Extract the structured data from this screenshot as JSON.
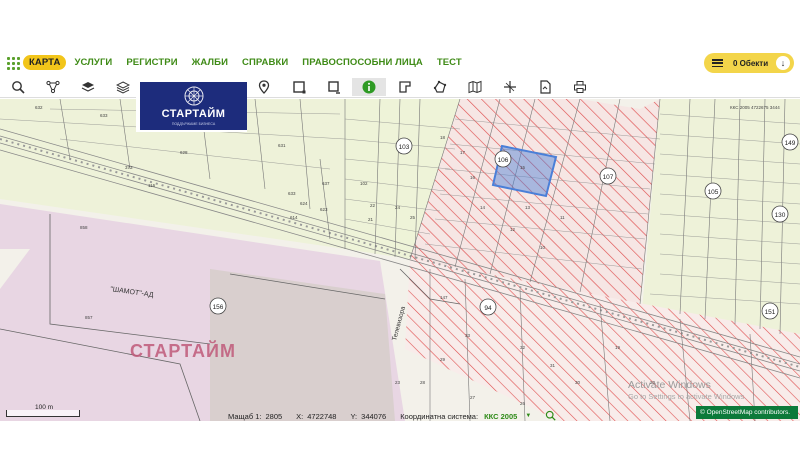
{
  "nav": {
    "items": [
      "КАРТА",
      "УСЛУГИ",
      "РЕГИСТРИ",
      "ЖАЛБИ",
      "СПРАВКИ",
      "ПРАВОСПОСОБНИ ЛИЦА",
      "ТЕСТ"
    ],
    "active": "КАРТА"
  },
  "objects_button": {
    "label": "0 Обекти"
  },
  "toolbar": {
    "tools": [
      "search-icon",
      "path-icon",
      "layers-icon",
      "layers-outline-icon",
      "location-pin-icon",
      "select-rectangle-icon",
      "select-area-icon",
      "info-icon",
      "parcel-icon",
      "polygon-icon",
      "map-icon",
      "coordinates-icon",
      "document-icon",
      "print-icon"
    ],
    "active_tool": "info-icon"
  },
  "logo": {
    "title": "СТАРТАЙМ",
    "subtitle": "ПОДДЪРЖАМЕ БИЗНЕСА"
  },
  "map": {
    "watermark": "СТАРТАЙМ",
    "factory_label": "\"ШАМОТ\"-АД",
    "street_label": "Телевизора",
    "header_text": "ККС 2005 4722675 3444",
    "blocks": [
      "103",
      "106",
      "107",
      "105",
      "149",
      "130",
      "151",
      "156"
    ],
    "parcels": [
      "632",
      "633",
      "620",
      "628",
      "630",
      "631",
      "637",
      "624",
      "623",
      "614",
      "373",
      "116",
      "148",
      "102",
      "22",
      "21",
      "24",
      "25",
      "18",
      "17",
      "16",
      "15",
      "14",
      "13",
      "12",
      "11",
      "10",
      "147",
      "33",
      "32",
      "31",
      "30",
      "29",
      "28",
      "27",
      "26",
      "23",
      "19",
      "20",
      "857",
      "858"
    ],
    "activate_line1": "Activate Windows",
    "activate_line2": "Go to Settings to activate Windows.",
    "osm_credit": "© OpenStreetMap contributors."
  },
  "scale_bar": {
    "label": "100 m"
  },
  "status": {
    "scale_label": "Мащаб 1:",
    "scale_value": "2805",
    "x_label": "X:",
    "x_value": "4722748",
    "y_label": "Y:",
    "y_value": "344076",
    "crs_label": "Координатна система:",
    "crs_value": "ККС 2005"
  },
  "colors": {
    "accent_green": "#3f8b17",
    "active_yellow": "#f2c51a",
    "hatch_red": "#e05050",
    "selection_blue": "#4a7fd8",
    "industrial_pink": "#e6d3e0",
    "agri_green": "#eef2d9"
  }
}
